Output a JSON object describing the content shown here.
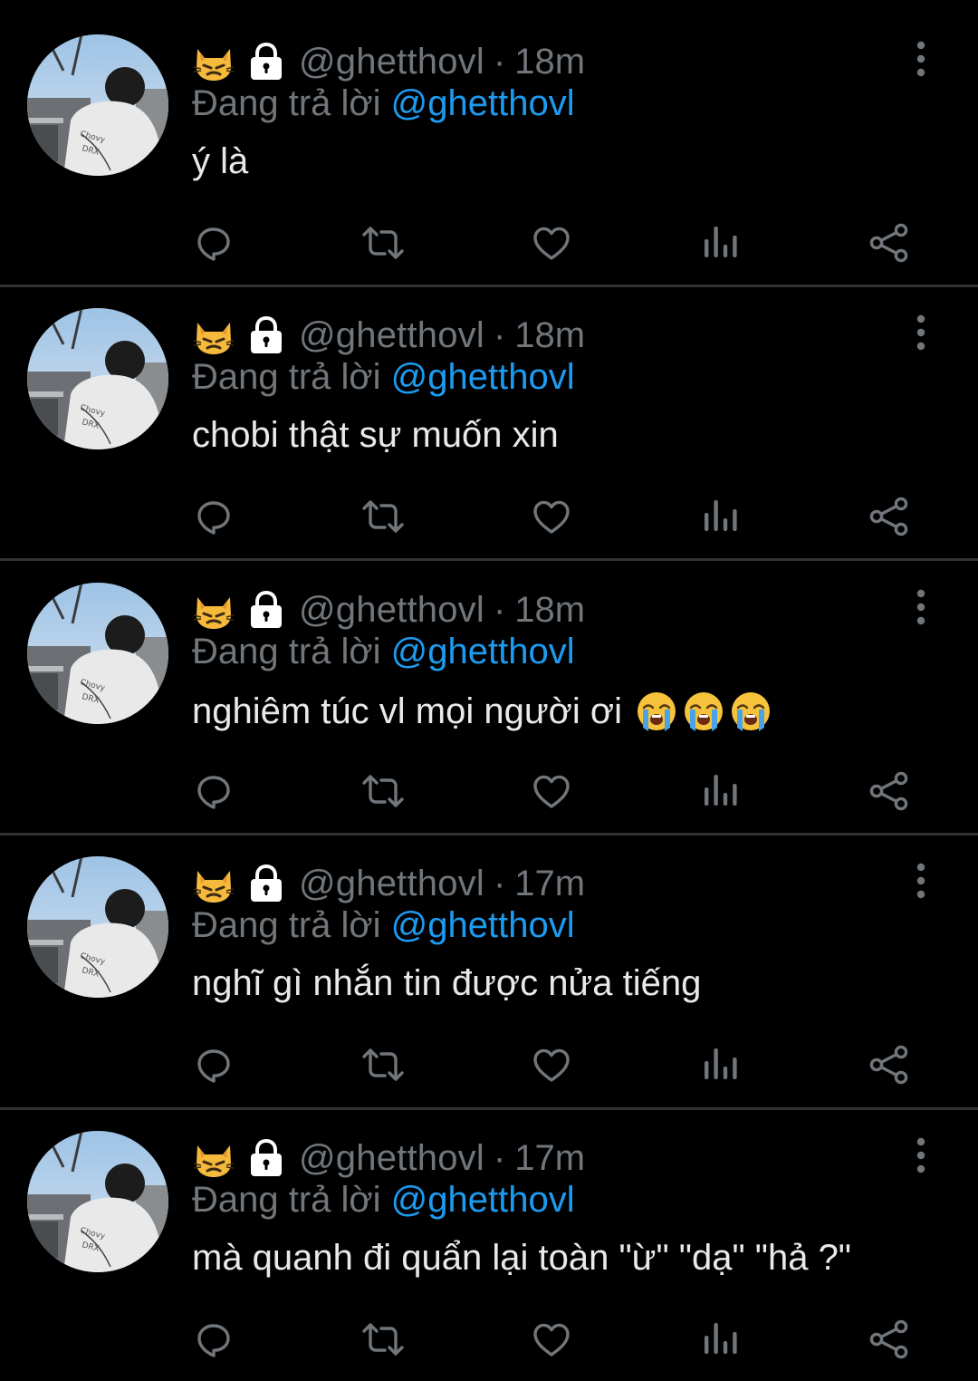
{
  "colors": {
    "background": "#000000",
    "text_primary": "#e7e9ea",
    "text_secondary": "#71767b",
    "mention": "#1d9bf0",
    "divider": "#2f3336"
  },
  "tweets": [
    {
      "display_icons": [
        "cat-emoji-icon",
        "lock-icon"
      ],
      "handle": "@ghetthovl",
      "separator": "·",
      "time": "18m",
      "reply_prefix": "Đang trả lời",
      "reply_mention": "@ghetthovl",
      "text": "ý là",
      "emojis": []
    },
    {
      "display_icons": [
        "cat-emoji-icon",
        "lock-icon"
      ],
      "handle": "@ghetthovl",
      "separator": "·",
      "time": "18m",
      "reply_prefix": "Đang trả lời",
      "reply_mention": "@ghetthovl",
      "text": "chobi thật sự muốn xin",
      "emojis": []
    },
    {
      "display_icons": [
        "cat-emoji-icon",
        "lock-icon"
      ],
      "handle": "@ghetthovl",
      "separator": "·",
      "time": "18m",
      "reply_prefix": "Đang trả lời",
      "reply_mention": "@ghetthovl",
      "text": "nghiêm túc vl mọi người ơi",
      "emojis": [
        "loudly-crying-face-icon",
        "loudly-crying-face-icon",
        "loudly-crying-face-icon"
      ]
    },
    {
      "display_icons": [
        "cat-emoji-icon",
        "lock-icon"
      ],
      "handle": "@ghetthovl",
      "separator": "·",
      "time": "17m",
      "reply_prefix": "Đang trả lời",
      "reply_mention": "@ghetthovl",
      "text": "nghĩ gì nhắn tin được nửa tiếng",
      "emojis": []
    },
    {
      "display_icons": [
        "cat-emoji-icon",
        "lock-icon"
      ],
      "handle": "@ghetthovl",
      "separator": "·",
      "time": "17m",
      "reply_prefix": "Đang trả lời",
      "reply_mention": "@ghetthovl",
      "text": "mà quanh đi quẩn lại toàn \"ừ\" \"dạ\" \"hả ?\"",
      "emojis": []
    }
  ],
  "action_icons": [
    "reply-icon",
    "retweet-icon",
    "like-icon",
    "views-icon",
    "share-icon"
  ]
}
